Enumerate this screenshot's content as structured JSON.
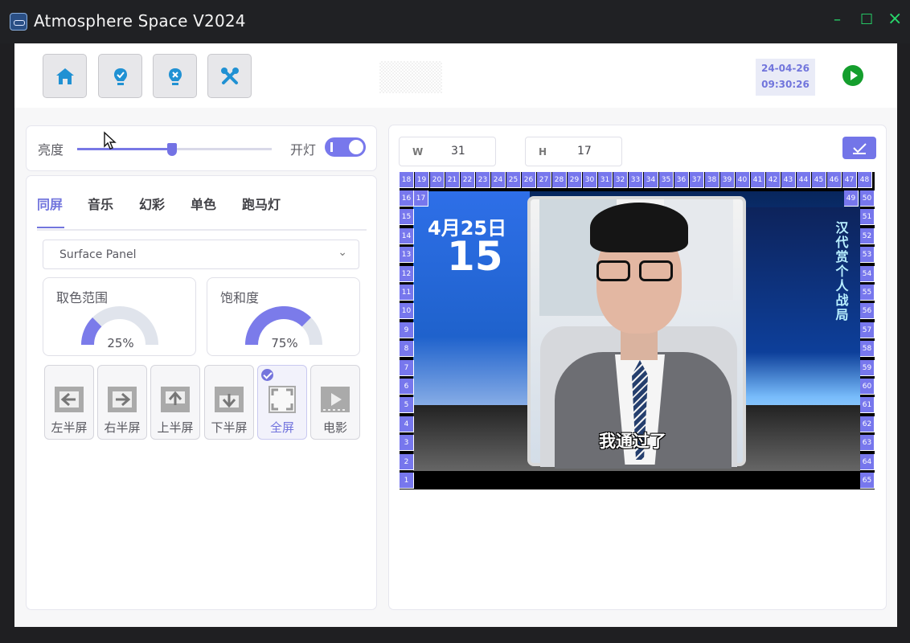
{
  "window": {
    "title": "Atmosphere Space V2024",
    "minimize": "–",
    "maximize": "□",
    "close": "×"
  },
  "toolbar": {
    "buttons": [
      {
        "name": "home-icon"
      },
      {
        "name": "bulb-check-icon"
      },
      {
        "name": "bulb-close-icon"
      },
      {
        "name": "tools-icon"
      }
    ],
    "date": "24-04-26",
    "time": "09:30:26"
  },
  "brightness": {
    "label": "亮度",
    "value": 0.49,
    "light_label": "开灯",
    "toggle_on": true
  },
  "tabs": [
    {
      "label": "同屏",
      "active": true
    },
    {
      "label": "音乐"
    },
    {
      "label": "幻彩"
    },
    {
      "label": "单色"
    },
    {
      "label": "跑马灯"
    }
  ],
  "source_select": {
    "value": "Surface Panel"
  },
  "controls": {
    "color_range": {
      "label": "取色范围",
      "value": "25%",
      "fraction": 0.25
    },
    "saturation": {
      "label": "饱和度",
      "value": "75%",
      "fraction": 0.75
    }
  },
  "modes": [
    {
      "label": "左半屏",
      "icon": "left-half-icon"
    },
    {
      "label": "右半屏",
      "icon": "right-half-icon"
    },
    {
      "label": "上半屏",
      "icon": "top-half-icon"
    },
    {
      "label": "下半屏",
      "icon": "bottom-half-icon"
    },
    {
      "label": "全屏",
      "icon": "fullscreen-icon",
      "active": true
    },
    {
      "label": "电影",
      "icon": "movie-icon"
    }
  ],
  "dimensions": {
    "w_label": "W",
    "w_value": "31",
    "h_label": "H",
    "h_value": "17"
  },
  "preview": {
    "date_text": "4月25日",
    "big_text": "15",
    "subtitle": "我通过了",
    "side_text": "汉代赏个人战局"
  },
  "led_labels": {
    "top": [
      "18",
      "19",
      "20",
      "21",
      "22",
      "23",
      "24",
      "25",
      "26",
      "27",
      "28",
      "29",
      "30",
      "31",
      "32",
      "33",
      "34",
      "35",
      "36",
      "37",
      "38",
      "39",
      "40",
      "41",
      "42",
      "43",
      "44",
      "45",
      "46",
      "47",
      "48"
    ],
    "left": [
      "16",
      "15",
      "14",
      "13",
      "12",
      "11",
      "10",
      "9",
      "8",
      "7",
      "6",
      "5",
      "4",
      "3",
      "2",
      "1"
    ],
    "inner_left": "17",
    "inner_right": "49",
    "right": [
      "50",
      "51",
      "52",
      "53",
      "54",
      "55",
      "56",
      "57",
      "58",
      "59",
      "60",
      "61",
      "62",
      "63",
      "64",
      "65"
    ]
  }
}
